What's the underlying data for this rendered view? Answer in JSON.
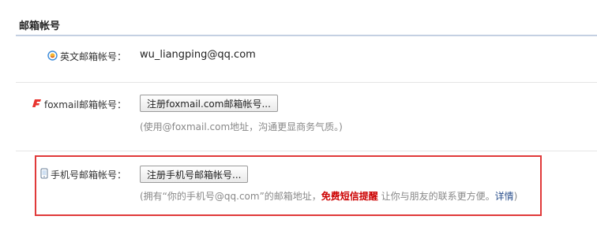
{
  "section": {
    "title": "邮箱帐号"
  },
  "english_account": {
    "label": "英文邮箱帐号：",
    "value": "wu_liangping@qq.com",
    "icon": "qq-mail-icon"
  },
  "foxmail_account": {
    "label": "foxmail邮箱帐号：",
    "button": "注册foxmail.com邮箱帐号...",
    "hint": "(使用@foxmail.com地址，沟通更显商务气质。)",
    "icon": "foxmail-icon"
  },
  "mobile_account": {
    "label": "手机号邮箱帐号：",
    "button": "注册手机号邮箱帐号...",
    "hint_prefix": "(拥有“你的手机号@qq.com”的邮箱地址，",
    "hint_highlight": "免费短信提醒",
    "hint_middle": " 让你与朋友的联系更方便。",
    "hint_link": "详情",
    "hint_suffix": ")",
    "icon": "mobile-phone-icon"
  },
  "colors": {
    "highlight_border": "#e03a3a",
    "title_rule": "#c4d0e2",
    "hint_text": "#888888",
    "emphasis_red": "#cc0000",
    "link_blue": "#2a4f8c"
  }
}
